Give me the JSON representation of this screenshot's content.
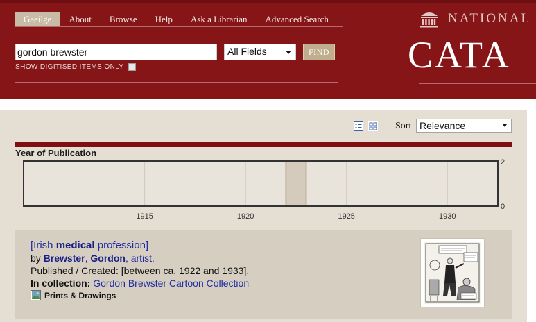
{
  "nav": {
    "items": [
      {
        "label": "Gaeilge",
        "active": true
      },
      {
        "label": "About"
      },
      {
        "label": "Browse"
      },
      {
        "label": "Help"
      },
      {
        "label": "Ask a Librarian"
      },
      {
        "label": "Advanced Search"
      }
    ]
  },
  "search": {
    "query": "gordon brewster",
    "field": "All Fields",
    "find_label": "FIND",
    "digitised_label": "SHOW DIGITISED ITEMS ONLY",
    "digitised_checked": false
  },
  "brand": {
    "small": "NATIONAL",
    "large": "CATA",
    "icon": "library-building-icon"
  },
  "toolbar": {
    "view_icons": [
      "list-view-icon",
      "grid-view-icon"
    ],
    "sort_label": "Sort",
    "sort_value": "Relevance"
  },
  "chart_data": {
    "type": "bar",
    "title": "Year of Publication",
    "x": [
      1922
    ],
    "values": [
      2
    ],
    "xlim": [
      1909,
      1932.5
    ],
    "xticks": [
      1915,
      1920,
      1925,
      1930
    ],
    "ylim": [
      0,
      2
    ],
    "yticks": [
      "2",
      "0"
    ],
    "grid": true,
    "colors": {
      "bar": "#d5cbbc",
      "bar_edge": "#bdb29c",
      "frame": "#333333",
      "plot_bg": "#e8e4dc"
    }
  },
  "result": {
    "title_open": "[Irish ",
    "title_bold": "medical",
    "title_close": " profession]",
    "by_prefix": "by ",
    "author_last": "Brewster",
    "author_sep": ", ",
    "author_first": "Gordon",
    "author_role": ", artist.",
    "published": "Published / Created: [between ca. 1922 and 1933].",
    "collection_label": "In collection:",
    "collection_value": "Gordon Brewster Cartoon Collection",
    "format": "Prints & Drawings",
    "format_icon": "image-format-icon",
    "thumbnail_icon": "cartoon-thumbnail"
  },
  "colors": {
    "header": "#861518",
    "content_bg": "#e4ded3",
    "result_bg": "#d6cfc1",
    "link": "#1f2da0"
  }
}
